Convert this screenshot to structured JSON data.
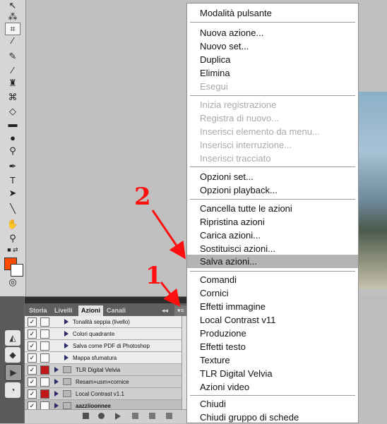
{
  "menu": {
    "items": [
      {
        "label": "Modalità pulsante",
        "disabled": false
      },
      {
        "label": "Nuova azione...",
        "disabled": false
      },
      {
        "label": "Nuovo set...",
        "disabled": false
      },
      {
        "label": "Duplica",
        "disabled": false
      },
      {
        "label": "Elimina",
        "disabled": false
      },
      {
        "label": "Esegui",
        "disabled": true
      },
      {
        "label": "Inizia registrazione",
        "disabled": true
      },
      {
        "label": "Registra di nuovo...",
        "disabled": true
      },
      {
        "label": "Inserisci elemento da menu...",
        "disabled": true
      },
      {
        "label": "Inserisci interruzione...",
        "disabled": true
      },
      {
        "label": "Inserisci tracciato",
        "disabled": true
      },
      {
        "label": "Opzioni set...",
        "disabled": false
      },
      {
        "label": "Opzioni playback...",
        "disabled": false
      },
      {
        "label": "Cancella tutte le azioni",
        "disabled": false
      },
      {
        "label": "Ripristina azioni",
        "disabled": false
      },
      {
        "label": "Carica azioni...",
        "disabled": false
      },
      {
        "label": "Sostituisci azioni...",
        "disabled": false
      },
      {
        "label": "Salva azioni...",
        "disabled": false,
        "highlighted": true
      },
      {
        "label": "Comandi",
        "disabled": false
      },
      {
        "label": "Cornici",
        "disabled": false
      },
      {
        "label": "Effetti immagine",
        "disabled": false
      },
      {
        "label": "Local Contrast v11",
        "disabled": false
      },
      {
        "label": "Produzione",
        "disabled": false
      },
      {
        "label": "Effetti testo",
        "disabled": false
      },
      {
        "label": "Texture",
        "disabled": false
      },
      {
        "label": "TLR Digital Velvia",
        "disabled": false
      },
      {
        "label": "Azioni video",
        "disabled": false
      },
      {
        "label": "Chiudi",
        "disabled": false
      },
      {
        "label": "Chiudi gruppo di schede",
        "disabled": false
      }
    ]
  },
  "panel": {
    "tabs": [
      "Storia",
      "Livelli",
      "Azioni",
      "Canali"
    ],
    "active_tab": "Azioni",
    "rows": [
      {
        "label": "Tonalità seppia (livello)",
        "type": "action"
      },
      {
        "label": "Colori quadrante",
        "type": "action"
      },
      {
        "label": "Salva come PDF di Photoshop",
        "type": "action"
      },
      {
        "label": "Mappa sfumatura",
        "type": "action"
      },
      {
        "label": "TLR Digital Velvia",
        "type": "set"
      },
      {
        "label": "Resam+usm+cornice",
        "type": "set"
      },
      {
        "label": "Local Contrast v1.1",
        "type": "set"
      },
      {
        "label": "aazziioonnee",
        "type": "set"
      }
    ],
    "collapse_glyph": "◂◂",
    "menu_glyph": "▾≡"
  },
  "annotations": {
    "step1": "1",
    "step2": "2"
  },
  "colors": {
    "foreground": "#ff4a00",
    "background": "#ffffff",
    "highlight": "#b4b4b4"
  }
}
